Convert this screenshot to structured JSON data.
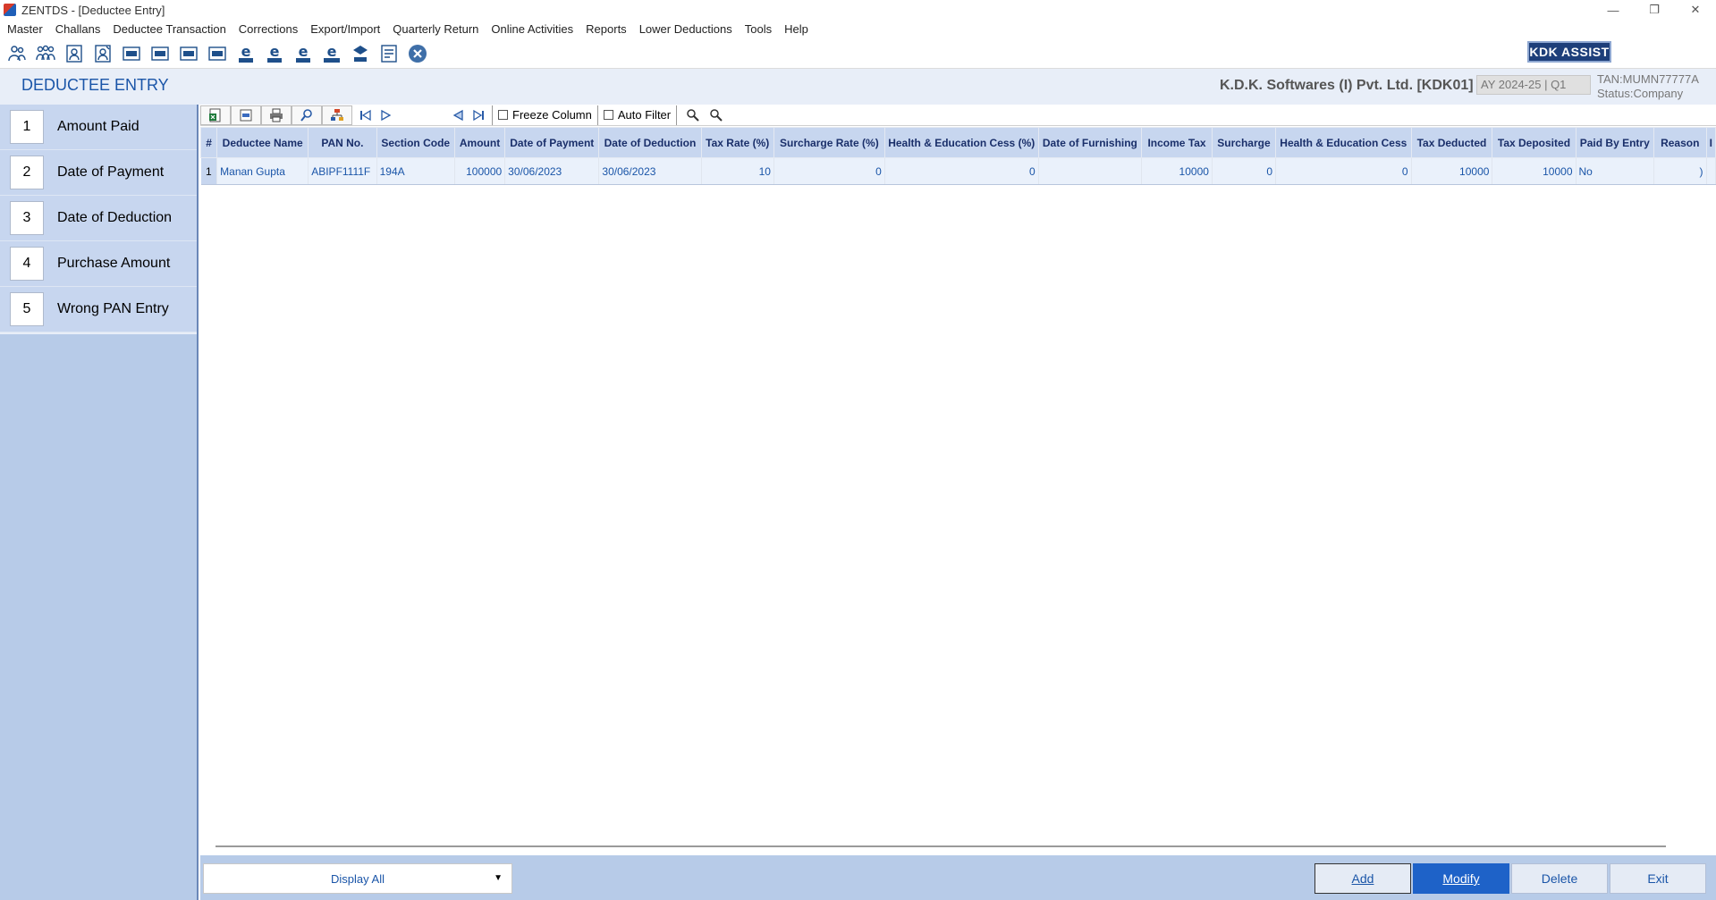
{
  "window": {
    "title": "ZENTDS - [Deductee Entry]",
    "minimize": "—",
    "restore": "❐",
    "close": "✕"
  },
  "menu": [
    "Master",
    "Challans",
    "Deductee Transaction",
    "Corrections",
    "Export/Import",
    "Quarterly Return",
    "Online Activities",
    "Reports",
    "Lower Deductions",
    "Tools",
    "Help"
  ],
  "toolbar": {
    "icons": [
      "users-icon",
      "group-icon",
      "user-add-icon",
      "user-edit-icon",
      "form-24q-icon",
      "form-26q-icon",
      "form-27q-icon",
      "form-27eq-icon",
      "efile-24q-icon",
      "efile-26q-icon",
      "efile-27q-icon",
      "efile-27eq-icon",
      "tds-icon",
      "report-icon",
      "close-circle-icon"
    ],
    "kdk_assist": "KDK ASSIST"
  },
  "header": {
    "page_title": "DEDUCTEE ENTRY",
    "company": "K.D.K. Softwares (I) Pvt. Ltd. [KDK01]",
    "ay": "AY 2024-25 | Q1",
    "tan": "TAN:MUMN77777A",
    "status": "Status:Company"
  },
  "sidebar": {
    "items": [
      {
        "num": "1",
        "label": "Amount Paid"
      },
      {
        "num": "2",
        "label": "Date of Payment"
      },
      {
        "num": "3",
        "label": "Date of Deduction"
      },
      {
        "num": "4",
        "label": "Purchase Amount"
      },
      {
        "num": "5",
        "label": "Wrong PAN Entry"
      }
    ]
  },
  "grid_toolbar": {
    "freeze_column": "Freeze Column",
    "auto_filter": "Auto Filter"
  },
  "grid": {
    "columns": [
      "#",
      "Deductee Name",
      "PAN No.",
      "Section Code",
      "Amount",
      "Date of Payment",
      "Date of Deduction",
      "Tax Rate (%)",
      "Surcharge Rate (%)",
      "Health & Education Cess (%)",
      "Date of Furnishing",
      "Income Tax",
      "Surcharge",
      "Health & Education Cess",
      "Tax Deducted",
      "Tax Deposited",
      "Paid By Entry",
      "Reason",
      "I"
    ],
    "rows": [
      [
        "1",
        "Manan Gupta",
        "ABIPF1111F",
        "194A",
        "100000",
        "30/06/2023",
        "30/06/2023",
        "10",
        "0",
        "0",
        "",
        "10000",
        "0",
        "0",
        "10000",
        "10000",
        "No",
        ")",
        ""
      ]
    ]
  },
  "footer": {
    "display": "Display All",
    "caret": "▼",
    "add": "Add",
    "modify": "Modify",
    "delete": "Delete",
    "exit": "Exit"
  }
}
